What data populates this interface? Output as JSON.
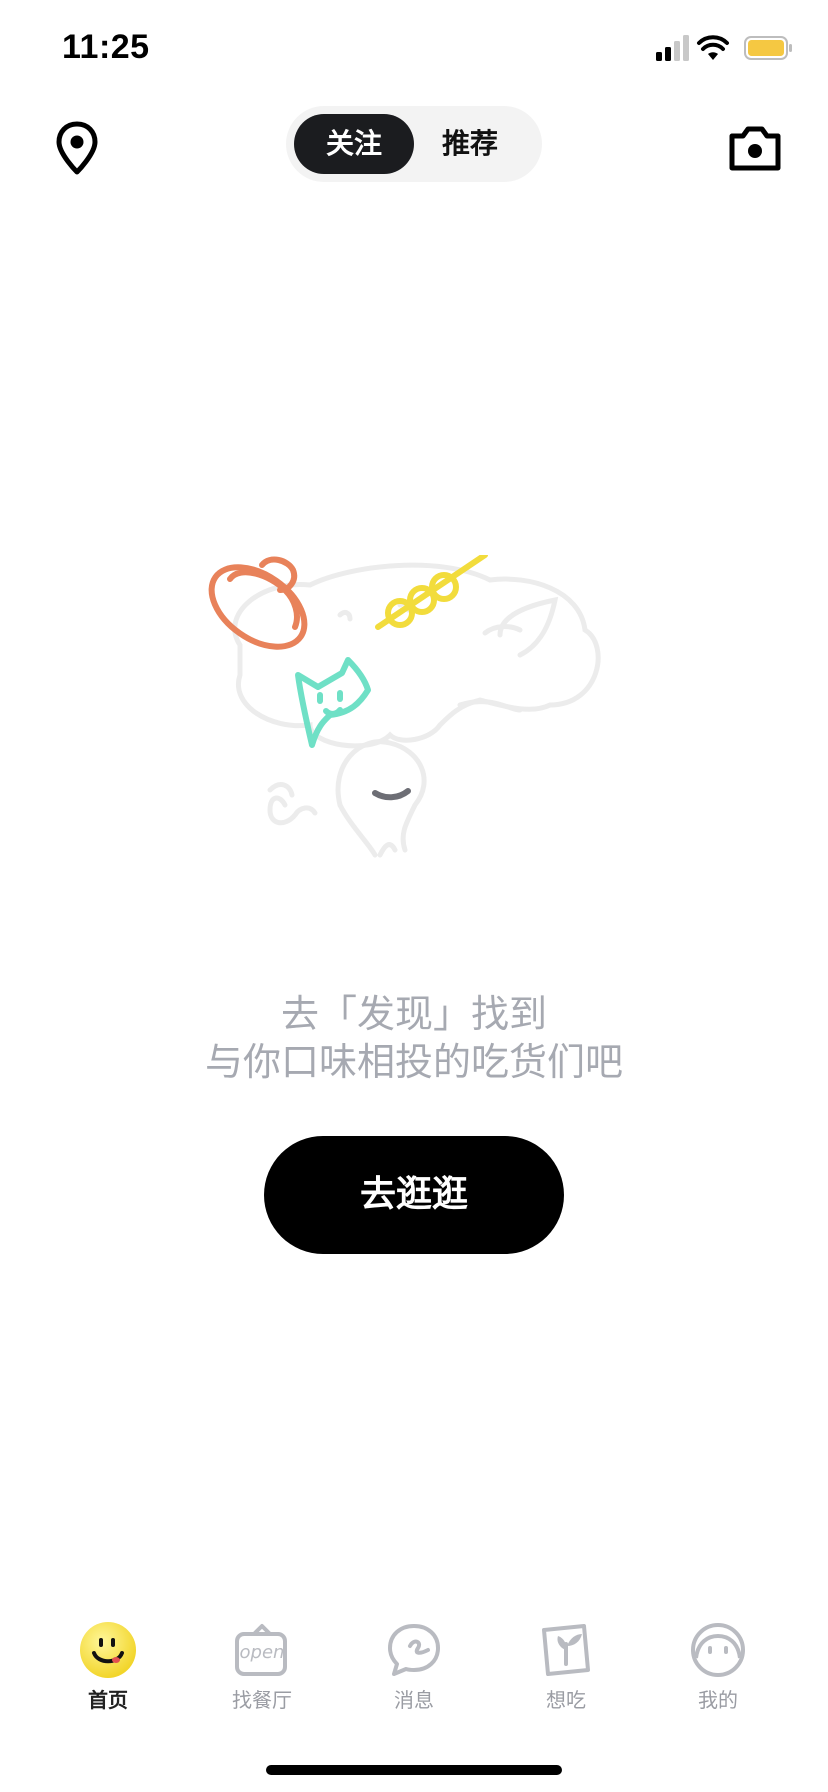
{
  "status_bar": {
    "time": "11:25"
  },
  "header": {
    "tabs": [
      {
        "label": "关注",
        "active": true
      },
      {
        "label": "推荐",
        "active": false
      }
    ],
    "location_icon": "map-pin-icon",
    "camera_icon": "camera-icon"
  },
  "empty_state": {
    "line1": "去「发现」找到",
    "line2": "与你口味相投的吃货们吧",
    "cta_label": "去逛逛"
  },
  "tab_bar": {
    "items": [
      {
        "label": "首页",
        "icon": "smiley-icon",
        "active": true
      },
      {
        "label": "找餐厅",
        "icon": "open-sign-icon",
        "active": false
      },
      {
        "label": "消息",
        "icon": "chat-bubble-icon",
        "active": false
      },
      {
        "label": "想吃",
        "icon": "sprout-icon",
        "active": false
      },
      {
        "label": "我的",
        "icon": "profile-face-icon",
        "active": false
      }
    ]
  },
  "colors": {
    "accent_dark": "#1b1c1f",
    "muted_text": "#a6a9b1",
    "battery": "#f5c842",
    "illustration_orange": "#e8825a",
    "illustration_yellow": "#f2dc3c",
    "illustration_teal": "#6fe0c6"
  }
}
